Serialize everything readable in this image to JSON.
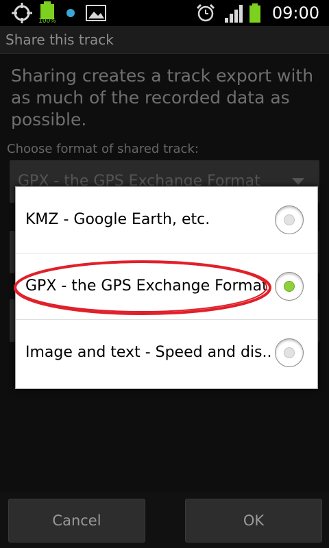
{
  "status_bar": {
    "time": "09:00",
    "battery_percent_label": "100%",
    "icons": [
      "gps-icon",
      "battery-full-icon",
      "notification-dot-icon",
      "image-icon",
      "alarm-icon",
      "signal-icon",
      "battery-charging-icon"
    ]
  },
  "title_bar": {
    "title": "Share this track"
  },
  "main": {
    "intro": "Sharing creates a track export with as much of the recorded data as possible.",
    "format_label": "Choose format of shared track:",
    "format_selected": "GPX - the GPS Exchange Format"
  },
  "popup": {
    "options": [
      {
        "label": "KMZ - Google Earth, etc.",
        "selected": false
      },
      {
        "label": "GPX - the GPS Exchange Format",
        "selected": true
      },
      {
        "label": "Image and text - Speed and dis..",
        "selected": false
      }
    ]
  },
  "buttons": {
    "cancel": "Cancel",
    "ok": "OK"
  },
  "colors": {
    "selected_radio": "#8fd13b",
    "annotation": "#e0202a",
    "battery": "#7bd11e"
  }
}
